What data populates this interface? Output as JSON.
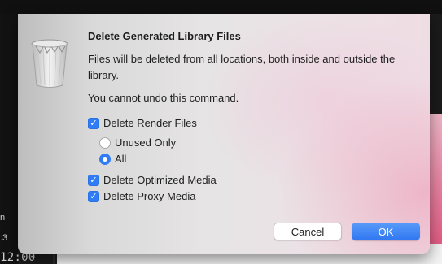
{
  "background": {
    "timecode": "12:00",
    "side_mark_1": "n",
    "side_mark_2": ":3"
  },
  "dialog": {
    "icon": "trash-icon",
    "title": "Delete Generated Library Files",
    "message": "Files will be deleted from all locations, both inside and outside the library.",
    "warning": "You cannot undo this command.",
    "options": {
      "render_files": {
        "label": "Delete Render Files",
        "checked": true
      },
      "unused_only": {
        "label": "Unused Only",
        "selected": false
      },
      "all": {
        "label": "All",
        "selected": true
      },
      "optimized_media": {
        "label": "Delete Optimized Media",
        "checked": true
      },
      "proxy_media": {
        "label": "Delete Proxy Media",
        "checked": true
      }
    },
    "buttons": {
      "cancel": "Cancel",
      "ok": "OK"
    },
    "accent_color": "#2f7cf6"
  }
}
